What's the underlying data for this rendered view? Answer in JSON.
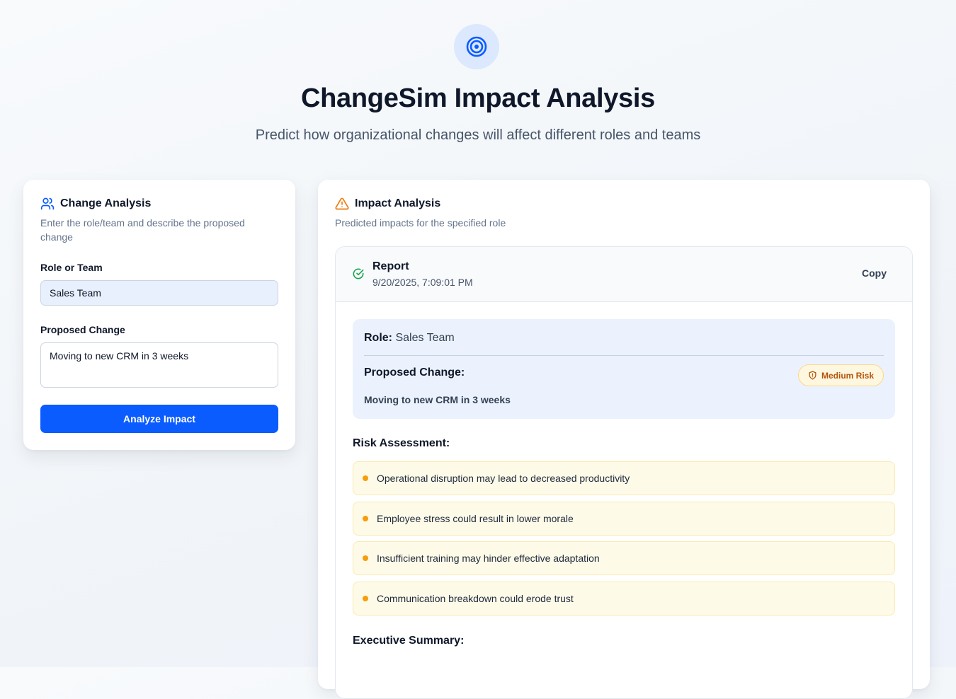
{
  "header": {
    "icon": "target-icon",
    "title": "ChangeSim Impact Analysis",
    "subtitle": "Predict how organizational changes will affect different roles and teams"
  },
  "form": {
    "icon": "users-icon",
    "title": "Change Analysis",
    "description": "Enter the role/team and describe the proposed change",
    "role_label": "Role or Team",
    "role_value": "Sales Team",
    "change_label": "Proposed Change",
    "change_value": "Moving to new CRM in 3 weeks",
    "submit_label": "Analyze Impact"
  },
  "impact": {
    "icon": "alert-triangle-icon",
    "title": "Impact Analysis",
    "description": "Predicted impacts for the specified role",
    "report": {
      "icon": "check-circle-icon",
      "title": "Report",
      "timestamp": "9/20/2025, 7:09:01 PM",
      "copy_label": "Copy",
      "role_label": "Role:",
      "role_value": "Sales Team",
      "change_label": "Proposed Change:",
      "change_value": "Moving to new CRM in 3 weeks",
      "risk_badge": "Medium Risk",
      "risk_badge_icon": "shield-icon",
      "risk_section_title": "Risk Assessment:",
      "risks": [
        "Operational disruption may lead to decreased productivity",
        "Employee stress could result in lower morale",
        "Insufficient training may hinder effective adaptation",
        "Communication breakdown could erode trust"
      ],
      "summary_section_title": "Executive Summary:"
    }
  },
  "colors": {
    "primary": "#0b5cff",
    "risk_accent": "#f59e0b",
    "risk_badge_text": "#b45309",
    "success": "#16a34a"
  }
}
